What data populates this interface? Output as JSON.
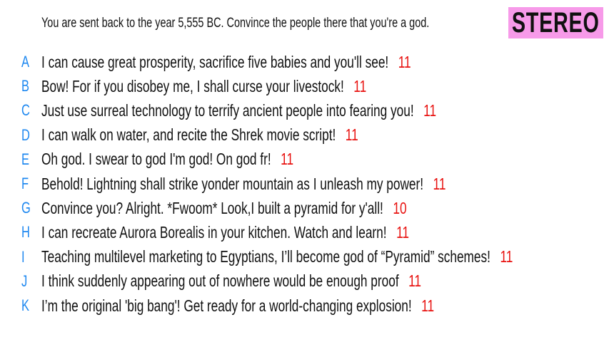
{
  "prompt": "You are sent back to the year 5,555 BC. Convince the people there that you're a god.",
  "logo": {
    "text": "STEREO",
    "background": "#f79ae9"
  },
  "colors": {
    "letter": "#1e88f0",
    "score": "#e8110f"
  },
  "answers": [
    {
      "letter": "A",
      "text": "I can cause great prosperity, sacrifice five babies and you'll see!",
      "score": "11"
    },
    {
      "letter": "B",
      "text": "Bow! For if you disobey me, I shall curse your livestock!",
      "score": "11"
    },
    {
      "letter": "C",
      "text": "Just use surreal technology to terrify ancient people into fearing you!",
      "score": "11"
    },
    {
      "letter": "D",
      "text": "I can walk on water, and recite the Shrek movie script!",
      "score": "11"
    },
    {
      "letter": "E",
      "text": "Oh god. I swear to god I'm god! On god fr!",
      "score": "11"
    },
    {
      "letter": "F",
      "text": "Behold! Lightning shall strike yonder mountain as I unleash my power!",
      "score": "11"
    },
    {
      "letter": "G",
      "text": "Convince you? Alright. *Fwoom* Look,I built a pyramid for y'all!",
      "score": "10"
    },
    {
      "letter": "H",
      "text": "I can recreate Aurora Borealis in your kitchen. Watch and learn!",
      "score": "11"
    },
    {
      "letter": "I",
      "text": "Teaching multilevel marketing to Egyptians, I’ll become god of “Pyramid” schemes!",
      "score": "11"
    },
    {
      "letter": "J",
      "text": "I think suddenly appearing out of nowhere would be enough proof",
      "score": "11"
    },
    {
      "letter": "K",
      "text": "I’m the original 'big bang'! Get ready for a world-changing explosion!",
      "score": "11"
    }
  ]
}
